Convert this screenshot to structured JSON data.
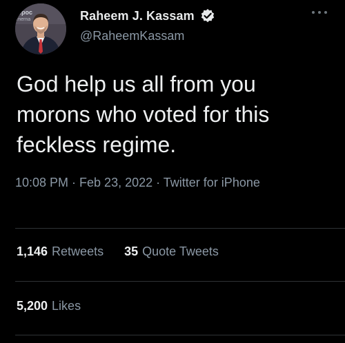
{
  "author": {
    "display_name": "Raheem J. Kassam",
    "handle": "@RaheemKassam",
    "avatar_icon": "profile-photo",
    "verified_icon": "verified-badge-icon",
    "avatar_backdrop_text": "epoc\nrnerna"
  },
  "tweet": {
    "text": "God help us all from you\nmorons who voted for this\nfeckless regime.",
    "meta": "10:08 PM · Feb 23, 2022 · Twitter for iPhone"
  },
  "stats": {
    "retweets_count": "1,146",
    "retweets_label": "Retweets",
    "quote_count": "35",
    "quote_label": "Quote Tweets",
    "likes_count": "5,200",
    "likes_label": "Likes"
  },
  "menu_icon": "more-dots-icon",
  "colors": {
    "background": "#000000",
    "text": "#e7e9ea",
    "secondary": "#8b98a5",
    "divider": "#2f3336"
  }
}
